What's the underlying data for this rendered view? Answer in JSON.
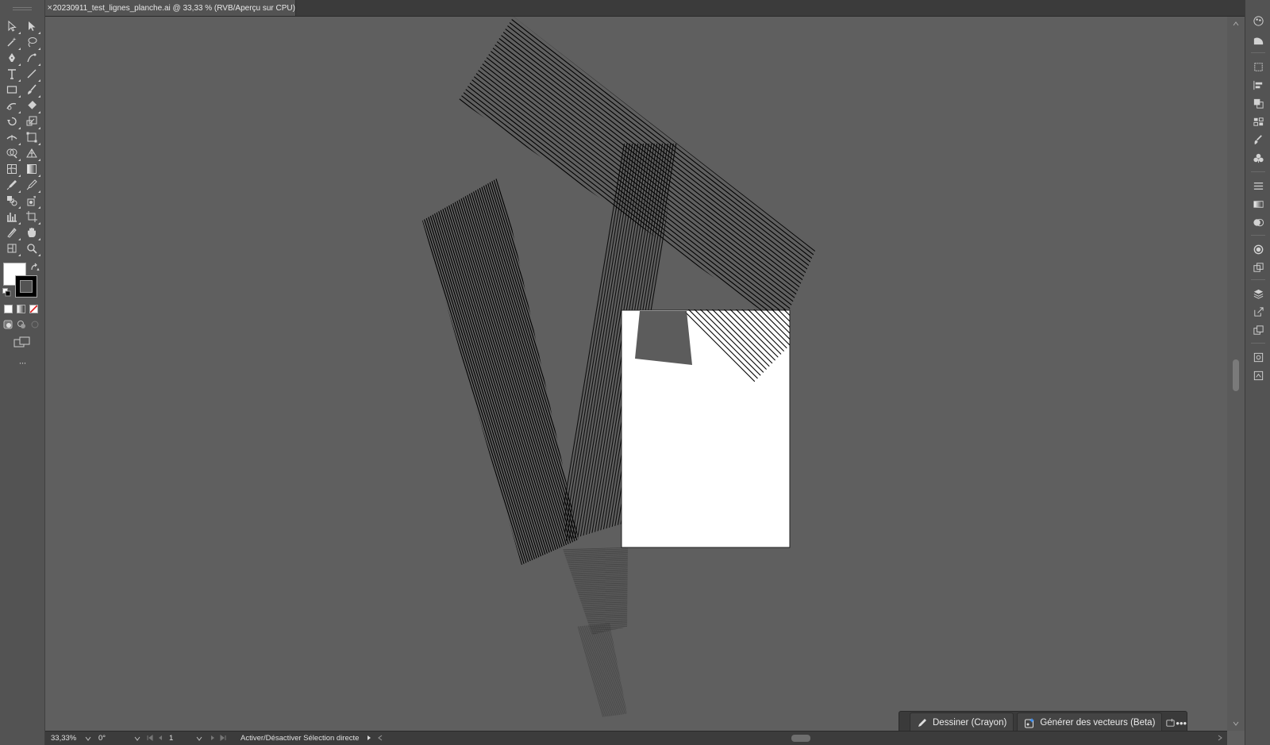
{
  "document_tab": {
    "close_glyph": "×",
    "title": "20230911_test_lignes_planche.ai @ 33,33 % (RVB/Aperçu sur CPU)"
  },
  "toolbar": {
    "more_glyph": "···",
    "tools": [
      {
        "row": 0,
        "col": 0,
        "icon": "selection-arrow-icon",
        "label": "Selection"
      },
      {
        "row": 0,
        "col": 1,
        "icon": "direct-selection-arrow-icon",
        "label": "Direct Selection"
      },
      {
        "row": 1,
        "col": 0,
        "icon": "magic-wand-icon",
        "label": "Magic Wand"
      },
      {
        "row": 1,
        "col": 1,
        "icon": "lasso-icon",
        "label": "Lasso"
      },
      {
        "row": 2,
        "col": 0,
        "icon": "pen-icon",
        "label": "Pen"
      },
      {
        "row": 2,
        "col": 1,
        "icon": "curvature-icon",
        "label": "Curvature"
      },
      {
        "row": 3,
        "col": 0,
        "icon": "type-icon",
        "label": "Type"
      },
      {
        "row": 3,
        "col": 1,
        "icon": "line-segment-icon",
        "label": "Line Segment"
      },
      {
        "row": 4,
        "col": 0,
        "icon": "rectangle-icon",
        "label": "Rectangle"
      },
      {
        "row": 4,
        "col": 1,
        "icon": "paintbrush-icon",
        "label": "Paintbrush"
      },
      {
        "row": 5,
        "col": 0,
        "icon": "shaper-icon",
        "label": "Shaper"
      },
      {
        "row": 5,
        "col": 1,
        "icon": "eraser-icon",
        "label": "Eraser"
      },
      {
        "row": 6,
        "col": 0,
        "icon": "rotate-icon",
        "label": "Rotate"
      },
      {
        "row": 6,
        "col": 1,
        "icon": "scale-icon",
        "label": "Scale"
      },
      {
        "row": 7,
        "col": 0,
        "icon": "width-icon",
        "label": "Width"
      },
      {
        "row": 7,
        "col": 1,
        "icon": "free-transform-icon",
        "label": "Free Transform"
      },
      {
        "row": 8,
        "col": 0,
        "icon": "shape-builder-icon",
        "label": "Shape Builder"
      },
      {
        "row": 8,
        "col": 1,
        "icon": "perspective-grid-icon",
        "label": "Perspective Grid"
      },
      {
        "row": 9,
        "col": 0,
        "icon": "mesh-icon",
        "label": "Mesh"
      },
      {
        "row": 9,
        "col": 1,
        "icon": "gradient-icon",
        "label": "Gradient"
      },
      {
        "row": 10,
        "col": 0,
        "icon": "eyedropper-icon",
        "label": "Eyedropper"
      },
      {
        "row": 10,
        "col": 1,
        "icon": "measure-icon",
        "label": "Measure"
      },
      {
        "row": 11,
        "col": 0,
        "icon": "blend-icon",
        "label": "Blend"
      },
      {
        "row": 11,
        "col": 1,
        "icon": "symbol-sprayer-icon",
        "label": "Symbol Sprayer"
      },
      {
        "row": 12,
        "col": 0,
        "icon": "column-graph-icon",
        "label": "Column Graph"
      },
      {
        "row": 12,
        "col": 1,
        "icon": "artboard-icon",
        "label": "Artboard"
      },
      {
        "row": 13,
        "col": 0,
        "icon": "slice-icon",
        "label": "Slice"
      },
      {
        "row": 13,
        "col": 1,
        "icon": "hand-icon",
        "label": "Hand"
      },
      {
        "row": 14,
        "col": 0,
        "icon": "print-tiling-icon",
        "label": "Print Tiling"
      },
      {
        "row": 14,
        "col": 1,
        "icon": "zoom-icon",
        "label": "Zoom"
      }
    ],
    "fill_color": "#ffffff",
    "stroke_color": "#000000"
  },
  "right_dock": {
    "icons": [
      "color-panel-icon",
      "color-guide-icon",
      "transform-icon",
      "align-icon",
      "pathfinder-icon",
      "swatches-icon",
      "brushes-icon",
      "symbols-icon",
      "stroke-icon",
      "gradient-panel-icon",
      "transparency-icon",
      "appearance-icon",
      "graphic-styles-icon",
      "layers-icon",
      "export-icon",
      "artboards-panel-icon",
      "properties-icon",
      "libraries-icon"
    ]
  },
  "task_bar": {
    "draw_label": "Dessiner (Crayon)",
    "generate_label": "Générer des vecteurs (Beta)",
    "more_glyph": "•••"
  },
  "status_bar": {
    "zoom": "33,33%",
    "rotation": "0°",
    "artboard_number": "1",
    "tool_hint": "Activer/Désactiver Sélection directe"
  },
  "colors": {
    "canvas": "#5f5f5f",
    "panel": "#535353",
    "artboard": "#ffffff",
    "stroke_lines": "#000000"
  }
}
